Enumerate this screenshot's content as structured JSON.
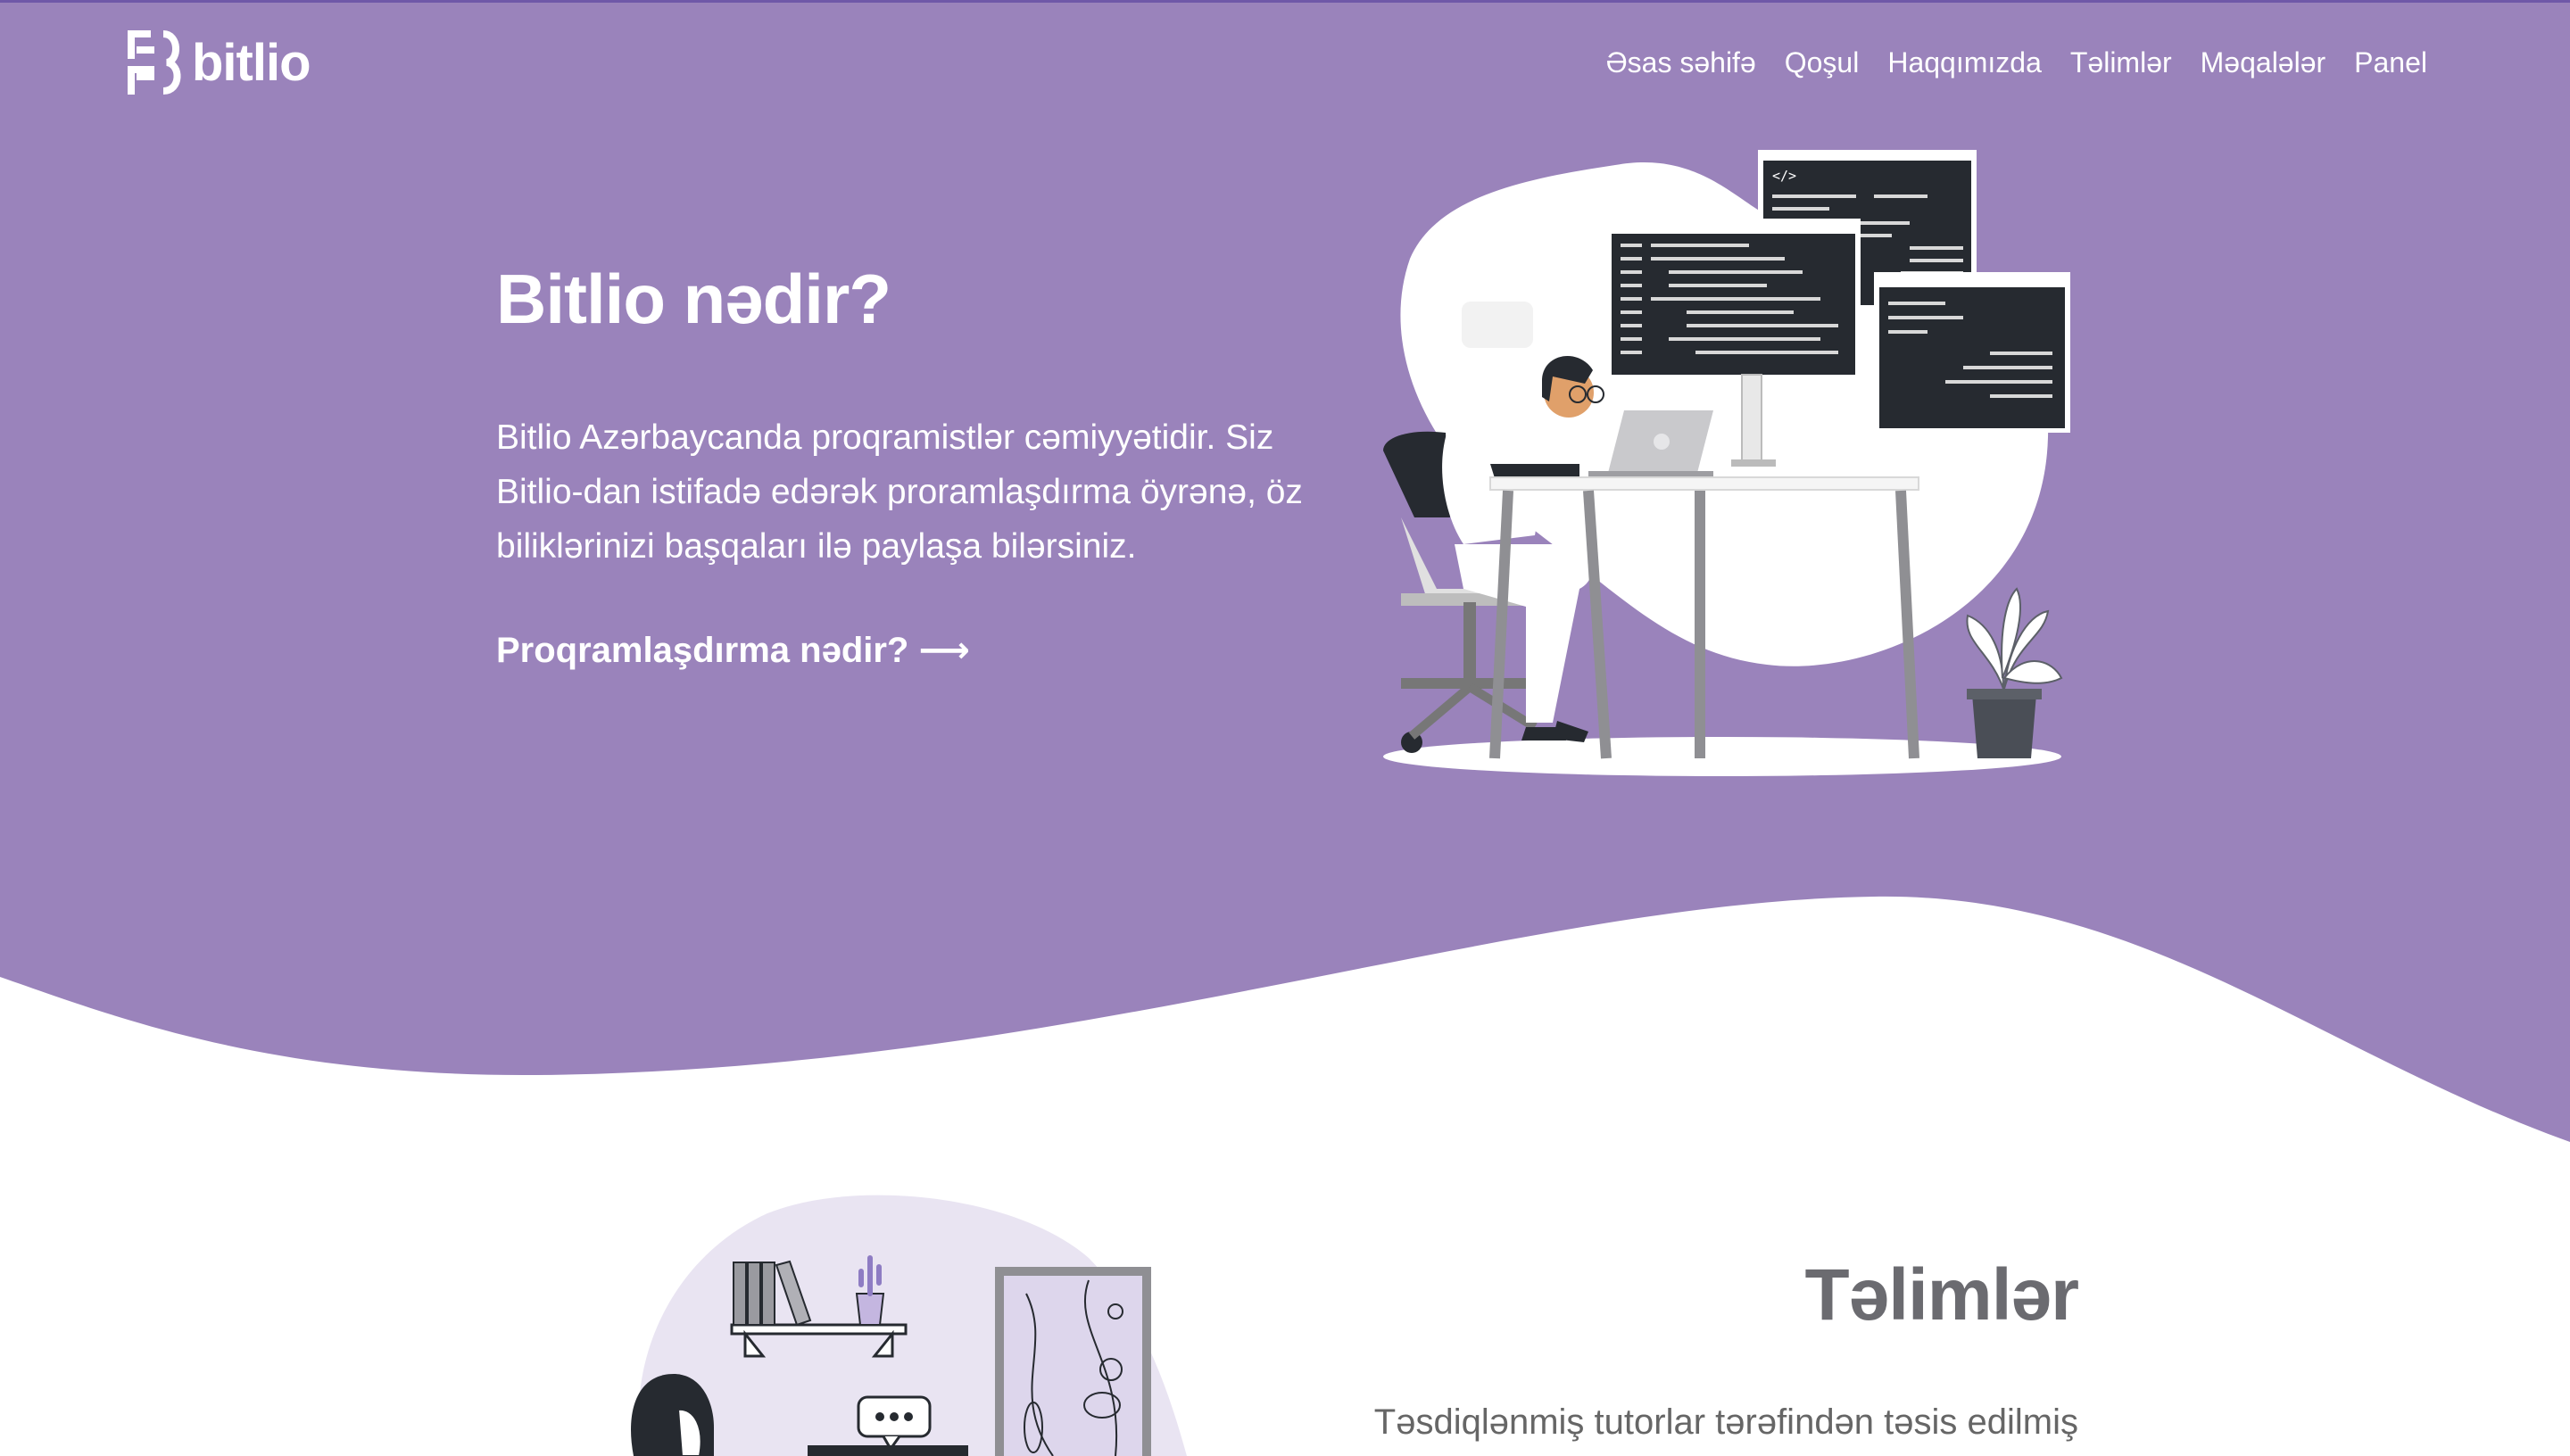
{
  "brand": {
    "name": "bitlio"
  },
  "colors": {
    "hero_bg": "#9a83bb",
    "accent": "#6f58a8",
    "text_light": "#ffffff",
    "heading_gray": "#6b6b70"
  },
  "nav": {
    "items": [
      "Əsas səhifə",
      "Qoşul",
      "Haqqımızda",
      "Təlimlər",
      "Məqalələr",
      "Panel"
    ]
  },
  "hero": {
    "title": "Bitlio nədir?",
    "description": "Bitlio Azərbaycanda proqramistlər cəmiyyətidir. Siz Bitlio-dan istifadə edərək proramlaşdırma öyrənə, öz biliklərinizi başqaları ilə paylaşa bilərsiniz.",
    "link": "Proqramlaşdırma nədir? ⟶",
    "illustration_icon": "developer-at-desk-illustration"
  },
  "section": {
    "title": "Təlimlər",
    "text": "Təsdiqlənmiş tutorlar tərəfindən təsis edilmiş",
    "illustration_icon": "person-with-bookshelf-illustration"
  },
  "code_window_tag": "</>"
}
